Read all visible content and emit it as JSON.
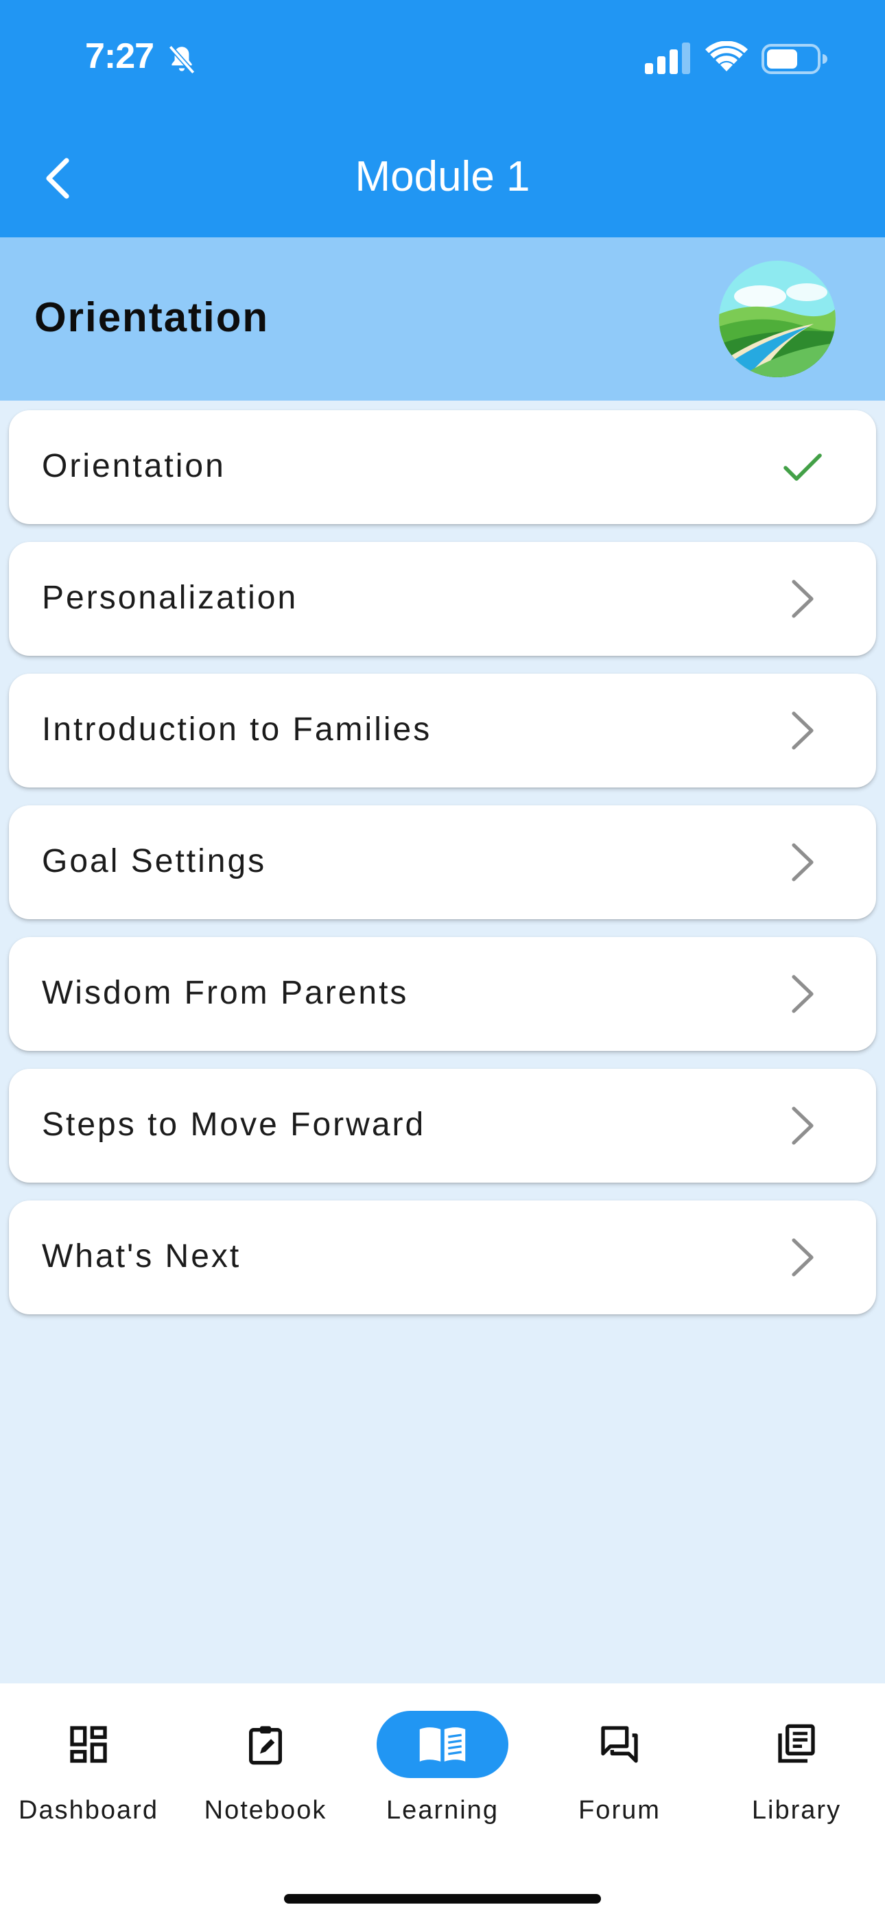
{
  "status_bar": {
    "time": "7:27",
    "icons": [
      "bell-off-icon",
      "signal-icon",
      "wifi-icon",
      "battery-icon"
    ]
  },
  "nav": {
    "title": "Module 1",
    "back_icon": "chevron-left-icon"
  },
  "section": {
    "title": "Orientation",
    "avatar": "landscape-road-image"
  },
  "lessons": [
    {
      "label": "Orientation",
      "status": "completed",
      "icon": "checkmark-icon"
    },
    {
      "label": "Personalization",
      "status": "open",
      "icon": "chevron-right-icon"
    },
    {
      "label": "Introduction to Families",
      "status": "open",
      "icon": "chevron-right-icon"
    },
    {
      "label": "Goal Settings",
      "status": "open",
      "icon": "chevron-right-icon"
    },
    {
      "label": "Wisdom From Parents",
      "status": "open",
      "icon": "chevron-right-icon"
    },
    {
      "label": "Steps to Move Forward",
      "status": "open",
      "icon": "chevron-right-icon"
    },
    {
      "label": "What's Next",
      "status": "open",
      "icon": "chevron-right-icon"
    }
  ],
  "tabs": [
    {
      "label": "Dashboard",
      "icon": "dashboard-icon",
      "active": false
    },
    {
      "label": "Notebook",
      "icon": "notebook-icon",
      "active": false
    },
    {
      "label": "Learning",
      "icon": "book-open-icon",
      "active": true
    },
    {
      "label": "Forum",
      "icon": "forum-icon",
      "active": false
    },
    {
      "label": "Library",
      "icon": "library-icon",
      "active": false
    }
  ],
  "colors": {
    "primary": "#2196F3",
    "section_header": "#90CAF9",
    "background": "#E1EFFB",
    "check_green": "#43A047",
    "chevron_gray": "#8E8E8E"
  }
}
